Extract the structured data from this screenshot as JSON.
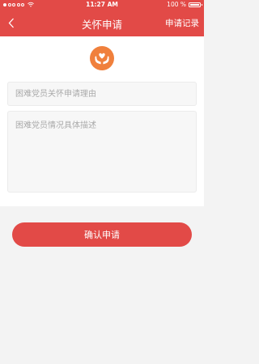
{
  "status_bar": {
    "time": "11:27 AM",
    "battery": "100 %"
  },
  "nav": {
    "title": "关怀申请",
    "right_link": "申请记录"
  },
  "form": {
    "reason_placeholder": "困难党员关怀申请理由",
    "description_placeholder": "困难党员情况具体描述"
  },
  "actions": {
    "confirm_label": "确认申请"
  },
  "colors": {
    "primary": "#e24a47",
    "logo_orange": "#f0803c",
    "background": "#f3f3f3"
  },
  "icons": {
    "back": "chevron-left-icon",
    "logo": "heart-hands-icon",
    "wifi": "wifi-icon",
    "battery": "battery-icon"
  }
}
